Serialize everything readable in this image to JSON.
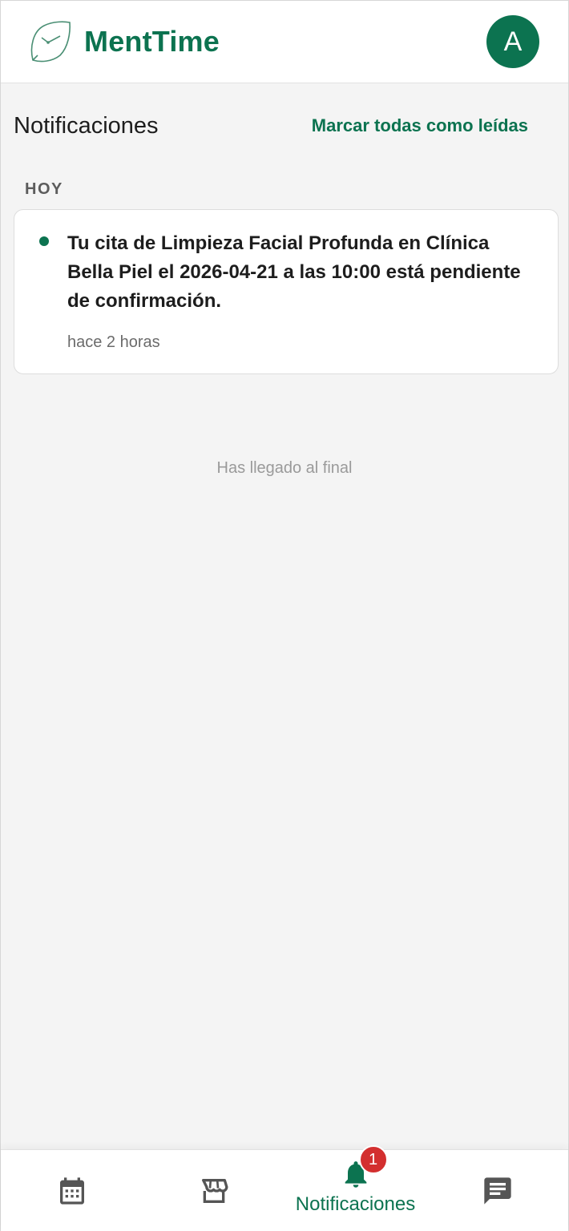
{
  "header": {
    "app_name": "MentTime",
    "avatar_initial": "A",
    "brand_color": "#0c7350"
  },
  "page": {
    "title": "Notificaciones",
    "mark_all_label": "Marcar todas como leídas"
  },
  "sections": [
    {
      "label": "HOY",
      "notifications": [
        {
          "message": "Tu cita de Limpieza Facial Profunda en Clínica Bella Piel el 2026-04-21 a las 10:00 está pendiente de confirmación.",
          "time": "hace 2 horas",
          "unread": true
        }
      ]
    }
  ],
  "end_text": "Has llegado al final",
  "bottom_nav": {
    "items": [
      {
        "icon": "calendar-icon"
      },
      {
        "icon": "store-icon"
      },
      {
        "icon": "bell-icon",
        "label": "Notificaciones",
        "badge": "1",
        "active": true
      },
      {
        "icon": "chat-icon"
      }
    ],
    "badge_color": "#d32f2f"
  }
}
